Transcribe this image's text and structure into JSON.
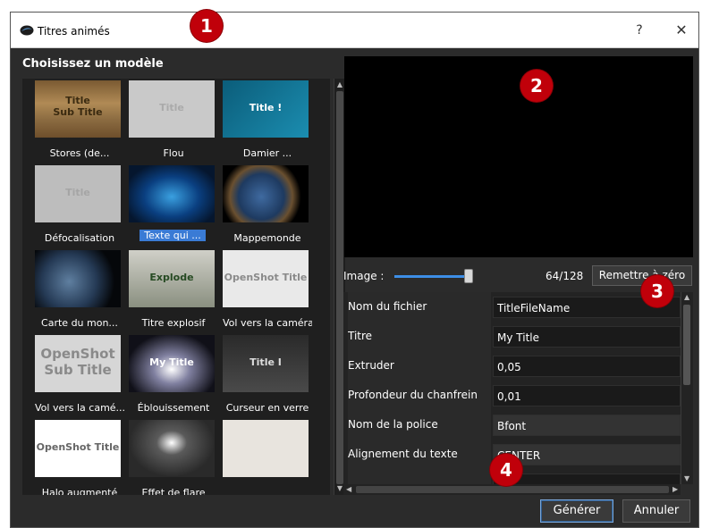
{
  "window": {
    "title": "Titres animés",
    "help": "?",
    "close": "✕"
  },
  "badges": [
    "1",
    "2",
    "3",
    "4"
  ],
  "left_panel": {
    "title": "Choisissez un modèle",
    "templates": [
      {
        "label": "Stores (de...",
        "thumb_text": "Title\nSub Title"
      },
      {
        "label": "Flou",
        "thumb_text": "Title"
      },
      {
        "label": "Damier ...",
        "thumb_text": "Title !"
      },
      {
        "label": "Défocalisation",
        "thumb_text": "Title"
      },
      {
        "label": "Texte qui ...",
        "selected": true,
        "thumb_text": ""
      },
      {
        "label": "Mappemonde",
        "thumb_text": ""
      },
      {
        "label": "Carte du mon...",
        "thumb_text": ""
      },
      {
        "label": "Titre explosif",
        "thumb_text": "Explode"
      },
      {
        "label": "Vol vers la caméra",
        "thumb_text": "OpenShot Title"
      },
      {
        "label": "Vol vers la camé...",
        "thumb_text": "OpenShot\nSub Title"
      },
      {
        "label": "Éblouissement",
        "thumb_text": "My Title"
      },
      {
        "label": "Curseur en verre",
        "thumb_text": "Title I"
      },
      {
        "label": "Halo augmenté",
        "thumb_text": "OpenShot Title"
      },
      {
        "label": "Effet de flare",
        "thumb_text": ""
      },
      {
        "label": "",
        "thumb_text": ""
      }
    ]
  },
  "image_row": {
    "label": "Image :",
    "frame": "64/128",
    "frame_fraction": 0.5,
    "reset_label": "Remettre à zéro"
  },
  "properties": [
    {
      "name": "Nom du fichier",
      "value": "TitleFileName"
    },
    {
      "name": "Titre",
      "value": "My Title"
    },
    {
      "name": "Extruder",
      "value": "0,05"
    },
    {
      "name": "Profondeur du chanfrein",
      "value": "0,01"
    },
    {
      "name": "Nom de la police",
      "value": "Bfont",
      "dropdown": true
    },
    {
      "name": "Alignement du texte",
      "value": "CENTER",
      "dropdown": true
    }
  ],
  "buttons": {
    "generate": "Générer",
    "cancel": "Annuler"
  },
  "colors": {
    "badge": "#c0000a",
    "selection": "#3a7bd5",
    "dialog_bg": "#2b2b2b"
  }
}
